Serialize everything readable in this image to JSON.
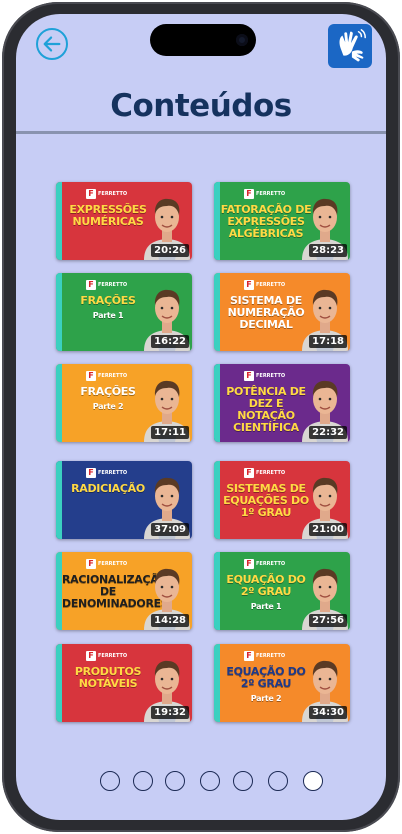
{
  "page": {
    "title": "Conteúdos"
  },
  "colors": {
    "background": "#c7cdf5",
    "title": "#15325e",
    "accent": "#1fa1d8"
  },
  "icons": {
    "back": "arrow-left-icon",
    "libras": "sign-language-icon"
  },
  "cards": [
    {
      "title": "EXPRESSÕES NUMÉRICAS",
      "subtitle": "",
      "duration": "20:26",
      "bg": "#d7353d",
      "textcolor": "#ffd944",
      "logo": "FERRETTO"
    },
    {
      "title": "FATORAÇÃO DE EXPRESSÕES ALGÉBRICAS",
      "subtitle": "",
      "duration": "28:23",
      "bg": "#2ea24a",
      "textcolor": "#ffd944",
      "logo": "FERRETTO"
    },
    {
      "title": "FRAÇÕES",
      "subtitle": "Parte 1",
      "duration": "16:22",
      "bg": "#2ea24a",
      "textcolor": "#ffd944",
      "logo": "FERRETTO"
    },
    {
      "title": "SISTEMA DE NUMERAÇÃO DECIMAL",
      "subtitle": "",
      "duration": "17:18",
      "bg": "#f58a2a",
      "textcolor": "#ffffff",
      "logo": "FERRETTO"
    },
    {
      "title": "FRAÇÕES",
      "subtitle": "Parte 2",
      "duration": "17:11",
      "bg": "#f7a227",
      "textcolor": "#ffffff",
      "logo": "FERRETTO"
    },
    {
      "title": "POTÊNCIA DE DEZ E NOTAÇÃO CIENTÍFICA",
      "subtitle": "",
      "duration": "22:32",
      "bg": "#6b2a8c",
      "textcolor": "#ffd944",
      "logo": "FERRETTO"
    },
    {
      "title": "RADICIAÇÃO",
      "subtitle": "",
      "duration": "37:09",
      "bg": "#243e8c",
      "textcolor": "#ffd944",
      "logo": "FERRETTO"
    },
    {
      "title": "SISTEMAS DE EQUAÇÕES DO 1º GRAU",
      "subtitle": "",
      "duration": "21:00",
      "bg": "#d7353d",
      "textcolor": "#ffd944",
      "logo": "FERRETTO"
    },
    {
      "title": "RACIONALIZAÇÃO DE DENOMINADORES",
      "subtitle": "",
      "duration": "14:28",
      "bg": "#f7a227",
      "textcolor": "#1f1f1f",
      "logo": "FERRETTO"
    },
    {
      "title": "EQUAÇÃO DO 2º GRAU",
      "subtitle": "Parte 1",
      "duration": "27:56",
      "bg": "#2ea24a",
      "textcolor": "#ffd944",
      "logo": "FERRETTO"
    },
    {
      "title": "PRODUTOS NOTÁVEIS",
      "subtitle": "",
      "duration": "19:32",
      "bg": "#d7353d",
      "textcolor": "#ffd944",
      "logo": "FERRETTO"
    },
    {
      "title": "EQUAÇÃO DO 2º GRAU",
      "subtitle": "Parte 2",
      "duration": "34:30",
      "bg": "#f58a2a",
      "textcolor": "#1f3a8a",
      "logo": "FERRETTO"
    }
  ],
  "pagination": {
    "total": 7,
    "active": 7
  }
}
